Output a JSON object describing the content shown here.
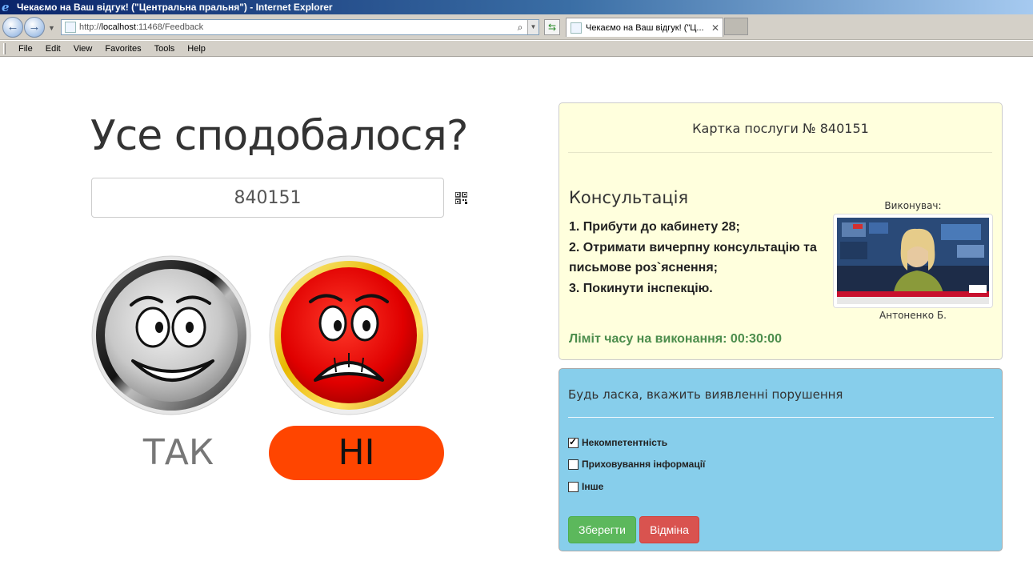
{
  "window": {
    "title": "Чекаємо на Ваш відгук! (\"Центральна пральня\") - Internet Explorer"
  },
  "address_bar": {
    "url_prefix": "http://",
    "url_host": "localhost",
    "url_rest": ":11468/Feedback"
  },
  "tab": {
    "title": "Чекаємо на Ваш відгук! (\"Ц..."
  },
  "menu": [
    "File",
    "Edit",
    "View",
    "Favorites",
    "Tools",
    "Help"
  ],
  "feedback": {
    "question": "Усе сподобалося?",
    "ticket_number": "840151",
    "yes_label": "ТАК",
    "no_label": "НІ"
  },
  "service_card": {
    "title": "Картка послуги № 840151",
    "service_name": "Консультація",
    "steps": [
      "1. Прибути до кабинету 28;",
      "2. Отримати вичерпну консультацію та письмове роз`яснення;",
      "3. Покинути інспекцію."
    ],
    "performer_label": "Виконувач:",
    "performer_name": "Антоненко Б.",
    "time_limit": "Ліміт часу на виконання: 00:30:00"
  },
  "violations": {
    "title": "Будь ласка, вкажить виявленні порушення",
    "options": [
      {
        "label": "Некомпетентність",
        "checked": true
      },
      {
        "label": "Приховування інформації",
        "checked": false
      },
      {
        "label": "Інше",
        "checked": false
      }
    ],
    "save_label": "Зберегти",
    "cancel_label": "Відміна"
  },
  "colors": {
    "no_button": "#ff4500",
    "card_bg": "#ffffdd",
    "panel_bg": "#87ceeb",
    "save": "#5cb85c",
    "cancel": "#d9534f",
    "time_limit": "#4c8d4c"
  }
}
